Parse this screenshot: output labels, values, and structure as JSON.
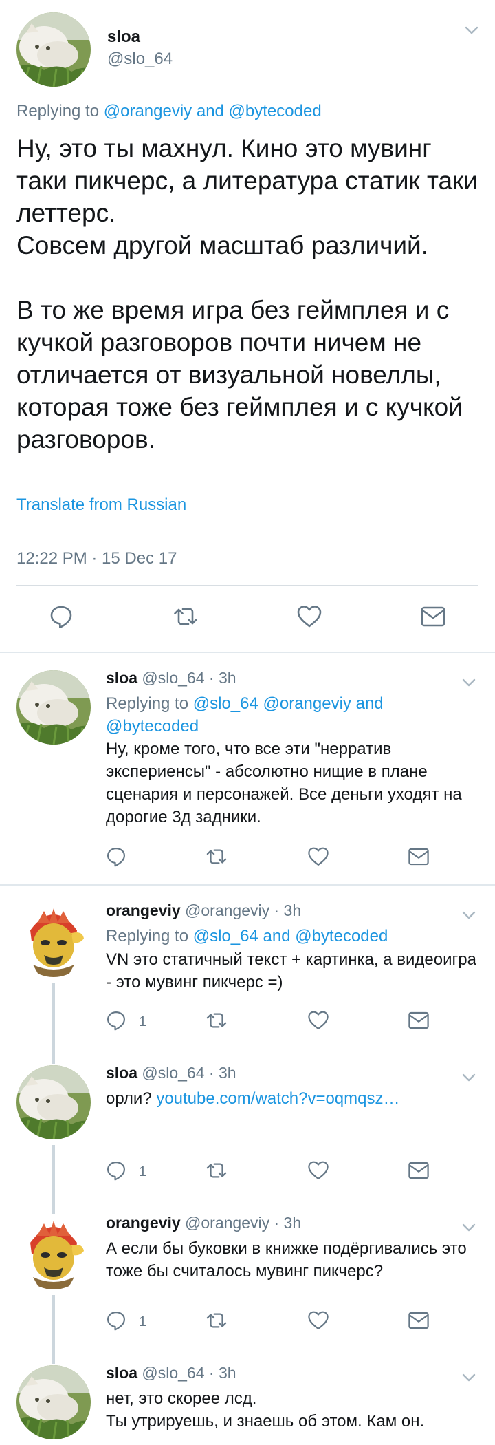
{
  "main_tweet": {
    "name": "sloa",
    "handle": "@slo_64",
    "replying_prefix": "Replying to ",
    "replying_to": "@orangeviy and @bytecoded",
    "text": "Ну, это ты махнул. Кино это мувинг таки пикчерс, а литература статик таки леттерс.\nСовсем другой масштаб различий.\n\nВ то же время игра без геймплея и с кучкой разговоров почти ничем не отличается от визуальной новеллы, которая тоже без геймплея и с кучкой разговоров.",
    "translate_label": "Translate from Russian",
    "timestamp": "12:22 PM · 15 Dec 17"
  },
  "replies": [
    {
      "name": "sloa",
      "meta": " @slo_64 · 3h",
      "replying_prefix": "Replying to ",
      "replying_to": "@slo_64 @orangeviy and @bytecoded",
      "text": "Ну, кроме того, что все эти \"нерратив экспериенсы\" - абсолютно нищие в плане сценария и персонажей. Все деньги уходят на дорогие 3д задники.",
      "reply_count": ""
    },
    {
      "name": "orangeviy",
      "meta": " @orangeviy · 3h",
      "replying_prefix": "Replying to ",
      "replying_to": "@slo_64 and @bytecoded",
      "text": "VN это статичный текст + картинка, а видеоигра - это мувинг пикчерс =)",
      "reply_count": "1"
    },
    {
      "name": "sloa",
      "meta": " @slo_64 · 3h",
      "text_prefix": "орли? ",
      "link": "youtube.com/watch?v=oqmqsz…",
      "reply_count": "1"
    },
    {
      "name": "orangeviy",
      "meta": " @orangeviy · 3h",
      "text": "А если бы буковки в книжке подёргивались это тоже бы считалось мувинг пикчерс?",
      "reply_count": "1"
    },
    {
      "name": "sloa",
      "meta": " @slo_64 · 3h",
      "text": "нет, это скорее лсд.\nТы утрируешь, и знаешь об этом. Кам он."
    }
  ],
  "icons": [
    "reply-icon",
    "retweet-icon",
    "like-icon",
    "message-icon",
    "chevron-down-icon"
  ],
  "colors": {
    "link": "#1b95e0",
    "secondary": "#657786",
    "icon": "#657786"
  }
}
